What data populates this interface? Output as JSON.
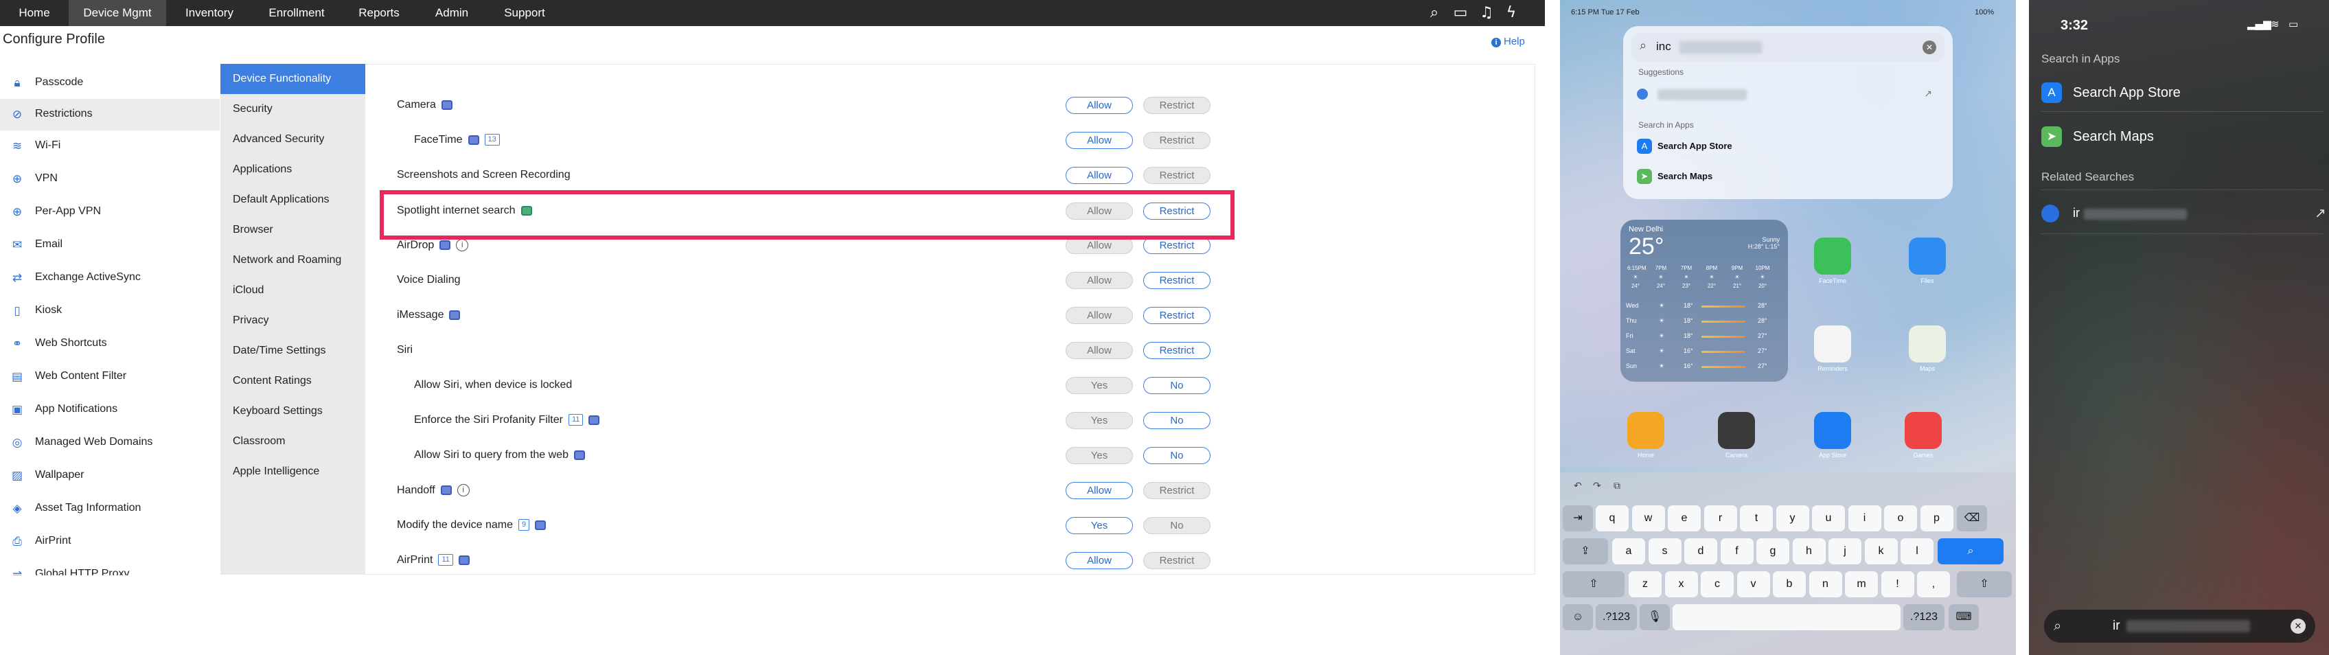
{
  "mdm": {
    "topnav": [
      "Home",
      "Device Mgmt",
      "Inventory",
      "Enrollment",
      "Reports",
      "Admin",
      "Support"
    ],
    "page_title": "Configure Profile",
    "help_label": "Help",
    "left_nav": [
      {
        "label": "Passcode",
        "icon": "lock-icon"
      },
      {
        "label": "Restrictions",
        "icon": "restrict-icon"
      },
      {
        "label": "Wi-Fi",
        "icon": "wifi-icon"
      },
      {
        "label": "VPN",
        "icon": "vpn-icon"
      },
      {
        "label": "Per-App VPN",
        "icon": "vpn-icon"
      },
      {
        "label": "Email",
        "icon": "mail-icon"
      },
      {
        "label": "Exchange ActiveSync",
        "icon": "sync-icon"
      },
      {
        "label": "Kiosk",
        "icon": "kiosk-icon"
      },
      {
        "label": "Web Shortcuts",
        "icon": "shortcut-icon"
      },
      {
        "label": "Web Content Filter",
        "icon": "filter-icon"
      },
      {
        "label": "App Notifications",
        "icon": "notification-icon"
      },
      {
        "label": "Managed Web Domains",
        "icon": "globe-icon"
      },
      {
        "label": "Wallpaper",
        "icon": "wallpaper-icon"
      },
      {
        "label": "Asset Tag Information",
        "icon": "tag-icon"
      },
      {
        "label": "AirPrint",
        "icon": "printer-icon"
      },
      {
        "label": "Global HTTP Proxy",
        "icon": "proxy-icon"
      }
    ],
    "mid_nav": [
      "Device Functionality",
      "Security",
      "Advanced Security",
      "Applications",
      "Default Applications",
      "Browser",
      "Network and Roaming",
      "iCloud",
      "Privacy",
      "Date/Time Settings",
      "Content Ratings",
      "Keyboard Settings",
      "Classroom",
      "Apple Intelligence"
    ],
    "rows": [
      {
        "label": "Camera",
        "badges": [
          "device"
        ],
        "options": [
          "Allow",
          "Restrict"
        ],
        "selected": 0,
        "indent": false
      },
      {
        "label": "FaceTime",
        "badges": [
          "device",
          "13"
        ],
        "options": [
          "Allow",
          "Restrict"
        ],
        "selected": 0,
        "indent": true
      },
      {
        "label": "Screenshots and Screen Recording",
        "badges": [],
        "options": [
          "Allow",
          "Restrict"
        ],
        "selected": 0,
        "indent": false
      },
      {
        "label": "Spotlight internet search",
        "badges": [
          "device-green"
        ],
        "options": [
          "Allow",
          "Restrict"
        ],
        "selected": 1,
        "indent": false
      },
      {
        "label": "AirDrop",
        "badges": [
          "device",
          "info"
        ],
        "options": [
          "Allow",
          "Restrict"
        ],
        "selected": 1,
        "indent": false
      },
      {
        "label": "Voice Dialing",
        "badges": [],
        "options": [
          "Allow",
          "Restrict"
        ],
        "selected": 1,
        "indent": false
      },
      {
        "label": "iMessage",
        "badges": [
          "device"
        ],
        "options": [
          "Allow",
          "Restrict"
        ],
        "selected": 1,
        "indent": false
      },
      {
        "label": "Siri",
        "badges": [],
        "options": [
          "Allow",
          "Restrict"
        ],
        "selected": 1,
        "indent": false
      },
      {
        "label": "Allow Siri, when device is locked",
        "badges": [],
        "options": [
          "Yes",
          "No"
        ],
        "selected": 1,
        "indent": true
      },
      {
        "label": "Enforce the Siri Profanity Filter",
        "badges": [
          "11",
          "device"
        ],
        "options": [
          "Yes",
          "No"
        ],
        "selected": 1,
        "indent": true
      },
      {
        "label": "Allow Siri to query from the web",
        "badges": [
          "device"
        ],
        "options": [
          "Yes",
          "No"
        ],
        "selected": 1,
        "indent": true
      },
      {
        "label": "Handoff",
        "badges": [
          "device",
          "info"
        ],
        "options": [
          "Allow",
          "Restrict"
        ],
        "selected": 0,
        "indent": false
      },
      {
        "label": "Modify the device name",
        "badges": [
          "9",
          "device"
        ],
        "options": [
          "Yes",
          "No"
        ],
        "selected": 0,
        "indent": false
      },
      {
        "label": "AirPrint",
        "badges": [
          "11",
          "device"
        ],
        "options": [
          "Allow",
          "Restrict"
        ],
        "selected": 0,
        "indent": false
      }
    ],
    "highlighted_row": "Spotlight internet search",
    "colors": {
      "topbar": "#2b2b2b",
      "accent": "#3d7fe0",
      "highlight": "#e8285c"
    }
  },
  "ipad": {
    "status_time": "6:15 PM  Tue 17 Feb",
    "status_battery": "100%",
    "search_query": "inc",
    "suggestions_header": "Suggestions",
    "search_in_apps_header": "Search in Apps",
    "app_results": [
      "Search App Store",
      "Search Maps"
    ],
    "weather": {
      "city": "New Delhi",
      "temp": "25°",
      "condition": "Sunny",
      "hilo": "H:28° L:15°",
      "hours": [
        "6:15PM",
        "7PM",
        "7PM",
        "8PM",
        "9PM",
        "10PM"
      ],
      "hour_temps": [
        "24°",
        "24°",
        "23°",
        "22°",
        "21°",
        "20°"
      ],
      "days": [
        {
          "d": "Wed",
          "lo": "18°",
          "hi": "28°"
        },
        {
          "d": "Thu",
          "lo": "18°",
          "hi": "28°"
        },
        {
          "d": "Fri",
          "lo": "18°",
          "hi": "27°"
        },
        {
          "d": "Sat",
          "lo": "16°",
          "hi": "27°"
        },
        {
          "d": "Sun",
          "lo": "16°",
          "hi": "27°"
        }
      ]
    },
    "apps": [
      "FaceTime",
      "Files",
      "Reminders",
      "Maps",
      "Home",
      "Camera",
      "App Store",
      "Games"
    ],
    "keyboard_rows": [
      [
        "q",
        "w",
        "e",
        "r",
        "t",
        "y",
        "u",
        "i",
        "o",
        "p"
      ],
      [
        "a",
        "s",
        "d",
        "f",
        "g",
        "h",
        "j",
        "k",
        "l"
      ],
      [
        "z",
        "x",
        "c",
        "v",
        "b",
        "n",
        "m",
        "!",
        ","
      ]
    ],
    "keyboard_mode": ".?123"
  },
  "iphone": {
    "time": "3:32",
    "search_in_apps": "Search in Apps",
    "results": [
      "Search App Store",
      "Search Maps"
    ],
    "related_searches": "Related Searches",
    "related_item": "ir",
    "query": "ir"
  }
}
